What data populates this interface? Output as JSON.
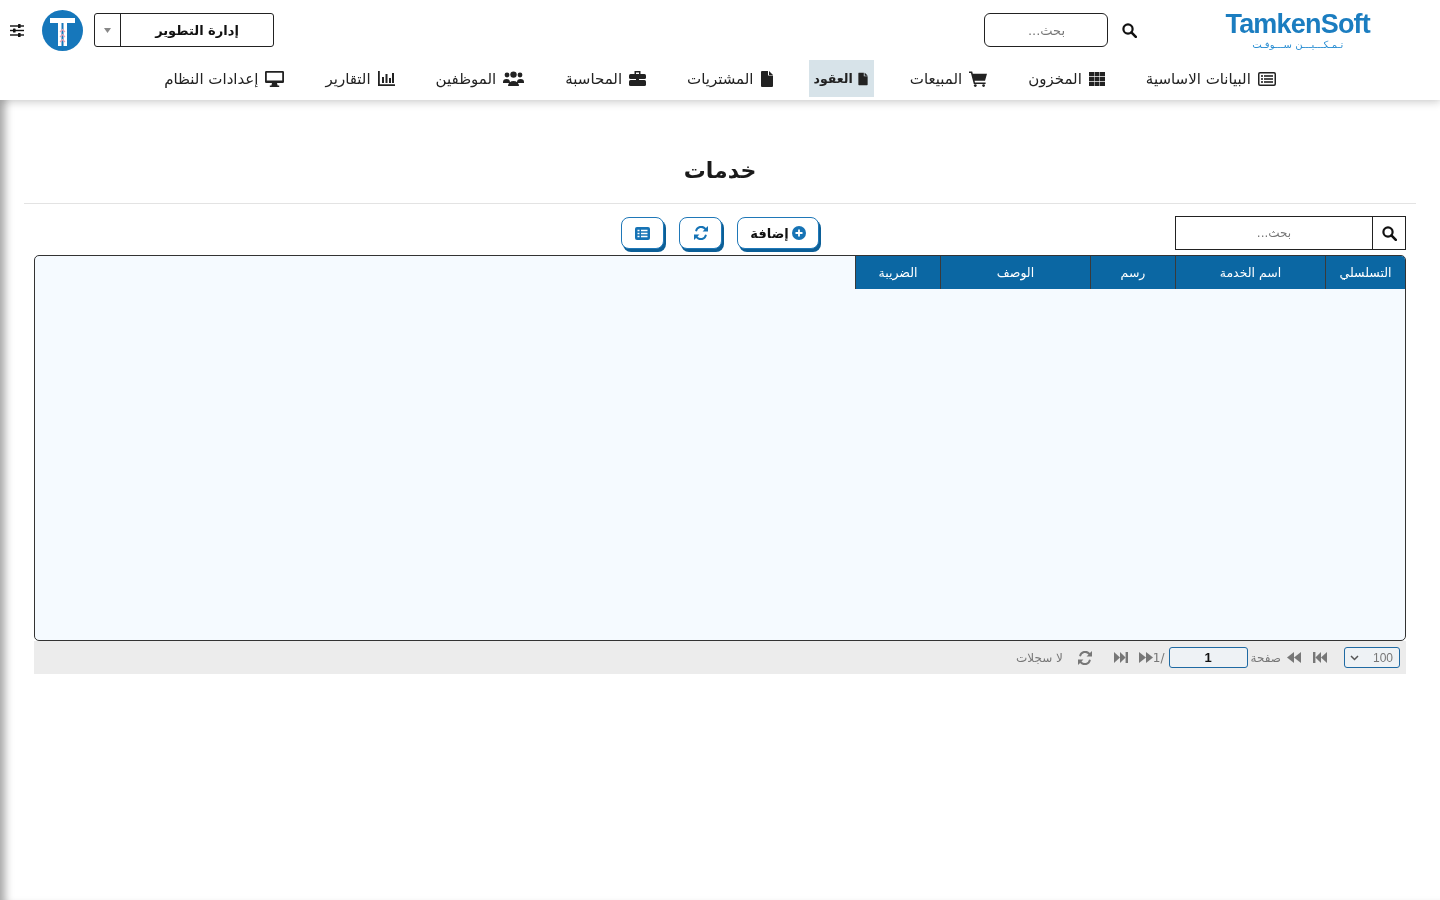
{
  "header": {
    "logo": {
      "name": "TamkenSoft",
      "tagline": "تـمـكـــيـــن ســـوفـت"
    },
    "search": {
      "placeholder": "بحث..."
    },
    "department": {
      "value": "إدارة التطوير"
    }
  },
  "nav": [
    {
      "label": "البيانات الاساسية",
      "selected": false
    },
    {
      "label": "المخزون",
      "selected": false
    },
    {
      "label": "المبيعات",
      "selected": false
    },
    {
      "label": "العقود",
      "selected": true
    },
    {
      "label": "المشتريات",
      "selected": false
    },
    {
      "label": "المحاسبة",
      "selected": false
    },
    {
      "label": "الموظفين",
      "selected": false
    },
    {
      "label": "التقارير",
      "selected": false
    },
    {
      "label": "إعدادات النظام",
      "selected": false
    }
  ],
  "page": {
    "title": "خدمات"
  },
  "toolbar": {
    "search": {
      "placeholder": "بحث..."
    },
    "add_button": {
      "label": "إضافة"
    }
  },
  "table": {
    "columns": [
      "التسلسلي",
      "اسم الخدمة",
      "رسم",
      "الوصف",
      "الضريبة"
    ]
  },
  "pager": {
    "page_size": "100",
    "page_label": "صفحة",
    "page": "1",
    "total": "/1",
    "status": "لا سجلات"
  }
}
